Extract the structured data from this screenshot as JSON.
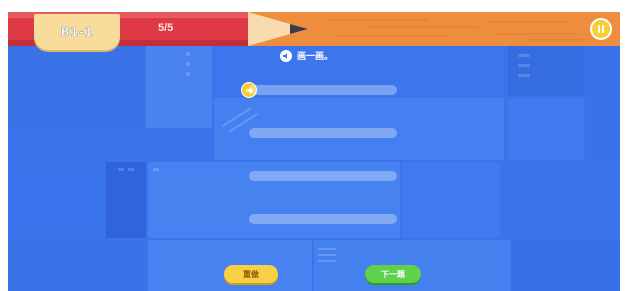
{
  "topbar": {
    "level": "B1-1",
    "progress": "5/5"
  },
  "prompt": {
    "text": "画一画。",
    "icon": "speaker-icon"
  },
  "buttons": {
    "reset": "重做",
    "next": "下一题"
  },
  "icons": {
    "pause": "pause-icon",
    "arrow": "arrow-right-icon"
  },
  "colors": {
    "pencil_red": "#dd3a45",
    "wood": "#ef8d3e",
    "board_blue": "#3a73ea",
    "accent_yellow": "#f6cf36",
    "next_green": "#5fd14a"
  }
}
